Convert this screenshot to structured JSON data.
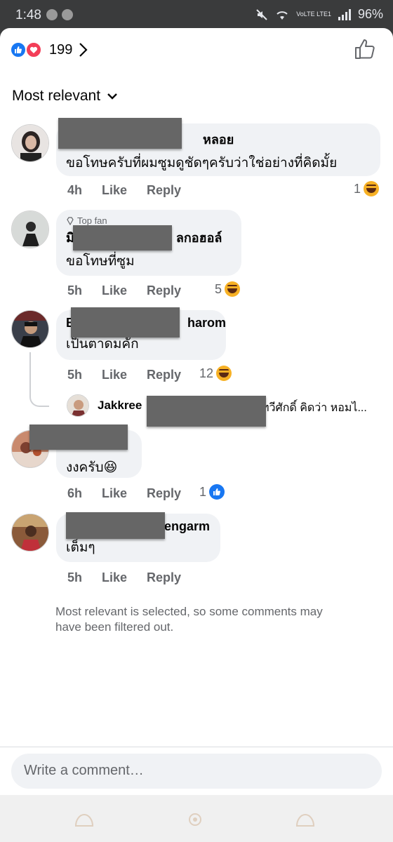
{
  "status_bar": {
    "time": "1:48",
    "network": "VoLTE LTE1",
    "battery": "96%"
  },
  "header": {
    "reaction_count": "199",
    "reaction_types": [
      "like",
      "love"
    ]
  },
  "sort": {
    "label": "Most relevant"
  },
  "comments": [
    {
      "name_visible": "หลอย",
      "text": "ขอโทษครับที่ผมซูมดูชัดๆครับว่าใช่อย่างที่คิดมั้ย",
      "time": "4h",
      "like_label": "Like",
      "reply_label": "Reply",
      "reaction_count": "1",
      "reaction_icon": "haha-icon"
    },
    {
      "badge": "Top fan",
      "name_visible_prefix": "มิ",
      "name_visible": "ลกอฮอล์",
      "text": "ขอโทษที่ซูม",
      "time": "5h",
      "like_label": "Like",
      "reply_label": "Reply",
      "reaction_count": "5",
      "reaction_icon": "haha-icon"
    },
    {
      "name_visible_prefix": "B",
      "name_visible": "harom",
      "text": "เป็นตาดมคัก",
      "time": "5h",
      "like_label": "Like",
      "reply_label": "Reply",
      "reaction_count": "12",
      "reaction_icon": "haha-icon",
      "reply_preview": {
        "name": "Jakkree",
        "text": "ทวีศักดิ์ คิดว่า หอมไ..."
      }
    },
    {
      "text": "งงครับ😆",
      "time": "6h",
      "like_label": "Like",
      "reply_label": "Reply",
      "reaction_count": "1",
      "reaction_icon": "like-icon"
    },
    {
      "name_visible": "engarm",
      "text": "เต็มๆ",
      "time": "5h",
      "like_label": "Like",
      "reply_label": "Reply"
    }
  ],
  "filter_note": "Most relevant is selected, so some comments may have been filtered out.",
  "composer": {
    "placeholder": "Write a comment…"
  },
  "colors": {
    "accent": "#1877f2",
    "love": "#f33e58",
    "haha": "#f7b125",
    "bubble": "#f0f2f5",
    "secondary_text": "#65676b"
  }
}
